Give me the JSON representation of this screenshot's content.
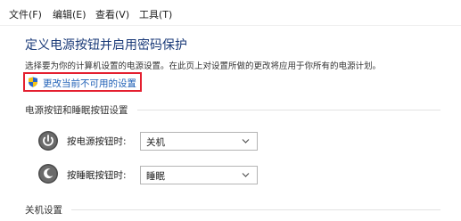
{
  "menu": {
    "items": [
      {
        "id": "file",
        "label": "文件(F)"
      },
      {
        "id": "edit",
        "label": "编辑(E)"
      },
      {
        "id": "view",
        "label": "查看(V)"
      },
      {
        "id": "tools",
        "label": "工具(T)"
      }
    ]
  },
  "page": {
    "title": "定义电源按钮并启用密码保护",
    "description": "选择要为你的计算机设置的电源设置。在此页上对设置所做的更改将应用于你所有的电源计划。",
    "change_link": "更改当前不可用的设置"
  },
  "sections": {
    "power_buttons": "电源按钮和睡眠按钮设置",
    "shutdown": "关机设置"
  },
  "settings": {
    "power_button_label": "按电源按钮时:",
    "power_button_value": "关机",
    "sleep_button_label": "按睡眠按钮时:",
    "sleep_button_value": "睡眠"
  },
  "icons": {
    "shield": "shield-icon",
    "power": "power-icon",
    "sleep": "sleep-icon",
    "dropdown": "chevron-down-icon"
  },
  "colors": {
    "title": "#1a3a78",
    "link": "#1e5fb6",
    "highlight_border": "#e41f2f"
  }
}
